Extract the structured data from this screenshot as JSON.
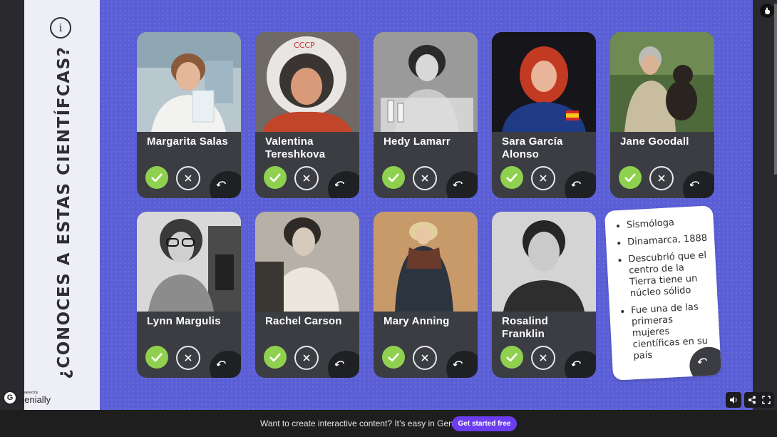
{
  "sidebar": {
    "title": "¿CONOCES A ESTAS CIENTÍFCAS?",
    "info_label": "i"
  },
  "cards": [
    {
      "name": "Margarita Salas"
    },
    {
      "name": "Valentina Tereshkova"
    },
    {
      "name": "Hedy Lamarr"
    },
    {
      "name": "Sara García Alonso"
    },
    {
      "name": "Jane Goodall"
    },
    {
      "name": "Lynn Margulis"
    },
    {
      "name": "Rachel Carson"
    },
    {
      "name": "Mary Anning"
    },
    {
      "name": "Rosalind Franklin"
    }
  ],
  "clue_card": {
    "items": [
      "Sismóloga",
      "Dinamarca, 1888",
      "Descubrió que el centro de la Tierra tiene un núcleo sólido",
      "Fue una de las primeras mujeres científicas en su país"
    ]
  },
  "branding": {
    "powered_by": "Powered by",
    "logo_text": "genially",
    "logo_letter": "G"
  },
  "footer": {
    "promo_text": "Want to create interactive content? It’s easy in Genially!",
    "cta_label": "Get started free"
  },
  "colors": {
    "stage": "#5b5fd6",
    "card": "#3b3d42",
    "check": "#8fd14f",
    "cta": "#6c3df0"
  }
}
